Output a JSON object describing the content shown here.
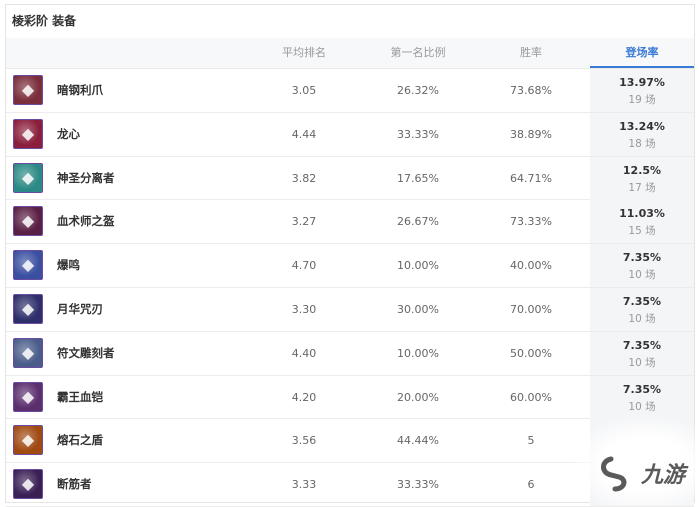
{
  "title": "棱彩阶 装备",
  "headers": {
    "avg_rank": "平均排名",
    "first_rate": "第一名比例",
    "win_rate": "胜率",
    "pick_rate": "登场率"
  },
  "items": [
    {
      "name": "暗钢利爪",
      "avg_rank": "3.05",
      "first_rate": "26.32%",
      "win_rate": "73.68%",
      "pick_rate": "13.97%",
      "games": "19 场",
      "icon": "claw-item-icon",
      "color": "#7a2d3a"
    },
    {
      "name": "龙心",
      "avg_rank": "4.44",
      "first_rate": "33.33%",
      "win_rate": "38.89%",
      "pick_rate": "13.24%",
      "games": "18 场",
      "icon": "dragon-heart-item-icon",
      "color": "#8a1e3c"
    },
    {
      "name": "神圣分离者",
      "avg_rank": "3.82",
      "first_rate": "17.65%",
      "win_rate": "64.71%",
      "pick_rate": "12.5%",
      "games": "17 场",
      "icon": "divine-separator-item-icon",
      "color": "#2c8a86"
    },
    {
      "name": "血术师之盔",
      "avg_rank": "3.27",
      "first_rate": "26.67%",
      "win_rate": "73.33%",
      "pick_rate": "11.03%",
      "games": "15 场",
      "icon": "bloodmage-helm-item-icon",
      "color": "#5a1f44"
    },
    {
      "name": "爆鸣",
      "avg_rank": "4.70",
      "first_rate": "10.00%",
      "win_rate": "40.00%",
      "pick_rate": "7.35%",
      "games": "10 场",
      "icon": "blast-item-icon",
      "color": "#3a4fa0"
    },
    {
      "name": "月华咒刃",
      "avg_rank": "3.30",
      "first_rate": "30.00%",
      "win_rate": "70.00%",
      "pick_rate": "7.35%",
      "games": "10 场",
      "icon": "lunar-blade-item-icon",
      "color": "#2e2f6a"
    },
    {
      "name": "符文雕刻者",
      "avg_rank": "4.40",
      "first_rate": "10.00%",
      "win_rate": "50.00%",
      "pick_rate": "7.35%",
      "games": "10 场",
      "icon": "rune-carver-item-icon",
      "color": "#4a5d8a"
    },
    {
      "name": "霸王血铠",
      "avg_rank": "4.20",
      "first_rate": "20.00%",
      "win_rate": "60.00%",
      "pick_rate": "7.35%",
      "games": "10 场",
      "icon": "overlord-armor-item-icon",
      "color": "#5b2e6e"
    },
    {
      "name": "熔石之盾",
      "avg_rank": "3.56",
      "first_rate": "44.44%",
      "win_rate": "5",
      "pick_rate": "",
      "games": "",
      "icon": "magma-shield-item-icon",
      "color": "#a04a12"
    },
    {
      "name": "断筋者",
      "avg_rank": "3.33",
      "first_rate": "33.33%",
      "win_rate": "6",
      "pick_rate": "",
      "games": "",
      "icon": "hamstring-item-icon",
      "color": "#3a1f55"
    }
  ],
  "watermark": "九游"
}
